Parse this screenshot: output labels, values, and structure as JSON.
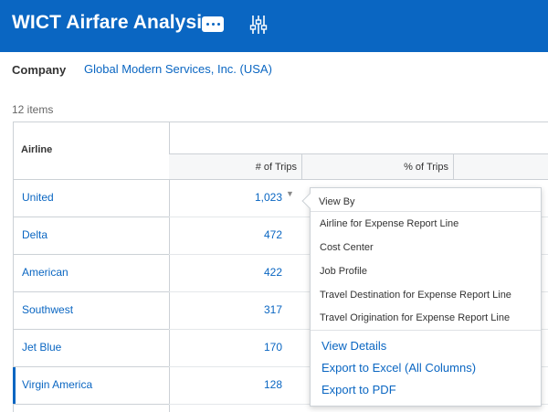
{
  "header": {
    "title": "WICT Airfare Analysis",
    "more_icon": "ellipsis-icon",
    "settings_icon": "sliders-icon",
    "brand_color": "#0a66c2"
  },
  "filter": {
    "company_label": "Company",
    "company_value": "Global Modern Services, Inc. (USA)"
  },
  "grid": {
    "items_count": "12 items",
    "columns": {
      "airline": "Airline",
      "trips": "# of Trips",
      "pct_trips": "% of Trips"
    },
    "rows": [
      {
        "airline": "United",
        "trips": "1,023"
      },
      {
        "airline": "Delta",
        "trips": "472"
      },
      {
        "airline": "American",
        "trips": "422"
      },
      {
        "airline": "Southwest",
        "trips": "317"
      },
      {
        "airline": "Jet Blue",
        "trips": "170"
      },
      {
        "airline": "Virgin America",
        "trips": "128"
      }
    ],
    "selected_row": "Virgin America"
  },
  "popup": {
    "heading": "View By",
    "options": [
      "Airline for Expense Report Line",
      "Cost Center",
      "Job Profile",
      "Travel Destination for Expense Report Line",
      "Travel Origination for Expense Report Line"
    ],
    "actions": [
      "View Details",
      "Export to Excel (All Columns)",
      "Export to PDF"
    ]
  }
}
